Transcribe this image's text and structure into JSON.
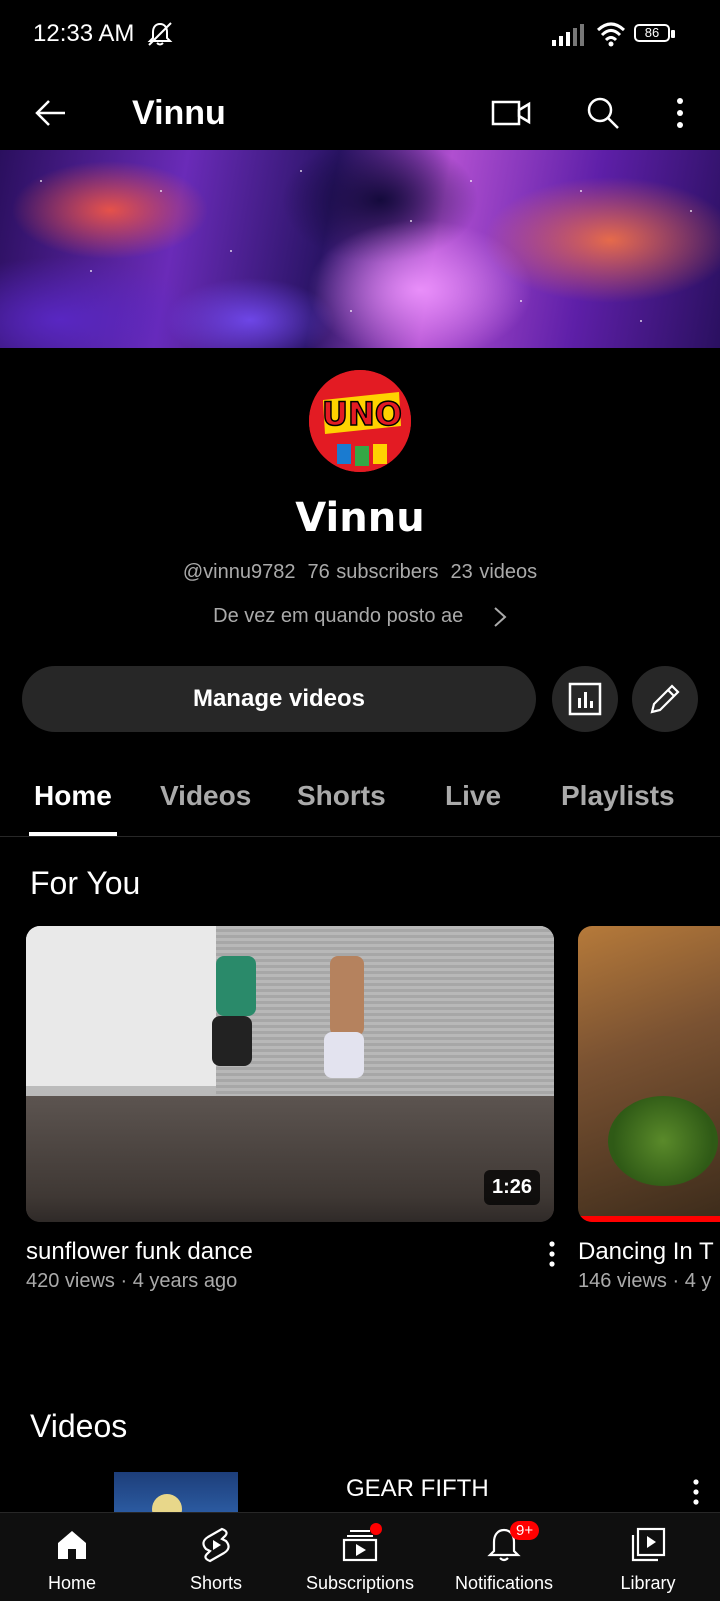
{
  "status_bar": {
    "time": "12:33 AM",
    "battery": "86",
    "icons": [
      "mute-icon",
      "signal-icon",
      "wifi-icon",
      "battery-icon"
    ]
  },
  "app_bar": {
    "title": "Vinnu",
    "icons": [
      "back-arrow-icon",
      "video-camera-icon",
      "search-icon",
      "more-vert-icon"
    ]
  },
  "channel": {
    "name": "Vinnu",
    "handle": "@vinnu9782",
    "subscribers": "76 subscribers",
    "videos": "23 videos",
    "description": "De vez em quando posto ae",
    "avatar_logo_text": "UNO"
  },
  "actions": {
    "manage_label": "Manage videos",
    "icons": [
      "analytics-icon",
      "edit-pencil-icon"
    ]
  },
  "tabs": [
    {
      "label": "Home",
      "active": true
    },
    {
      "label": "Videos",
      "active": false
    },
    {
      "label": "Shorts",
      "active": false
    },
    {
      "label": "Live",
      "active": false
    },
    {
      "label": "Playlists",
      "active": false
    }
  ],
  "for_you": {
    "title": "For You",
    "videos": [
      {
        "title": "sunflower funk dance",
        "meta": "420 views · 4 years ago",
        "duration": "1:26"
      },
      {
        "title": "Dancing In T",
        "meta": "146 views · 4 y"
      }
    ]
  },
  "videos_section": {
    "title": "Videos",
    "first_video_title": "GEAR FIFTH"
  },
  "bottom_nav": [
    {
      "label": "Home",
      "icon": "home-icon"
    },
    {
      "label": "Shorts",
      "icon": "shorts-icon"
    },
    {
      "label": "Subscriptions",
      "icon": "subscriptions-icon"
    },
    {
      "label": "Notifications",
      "icon": "bell-icon",
      "badge": "9+"
    },
    {
      "label": "Library",
      "icon": "library-icon"
    }
  ],
  "colors": {
    "background": "#000000",
    "surface": "#272727",
    "secondary_text": "#aaaaaa",
    "accent_red": "#ff0000"
  }
}
